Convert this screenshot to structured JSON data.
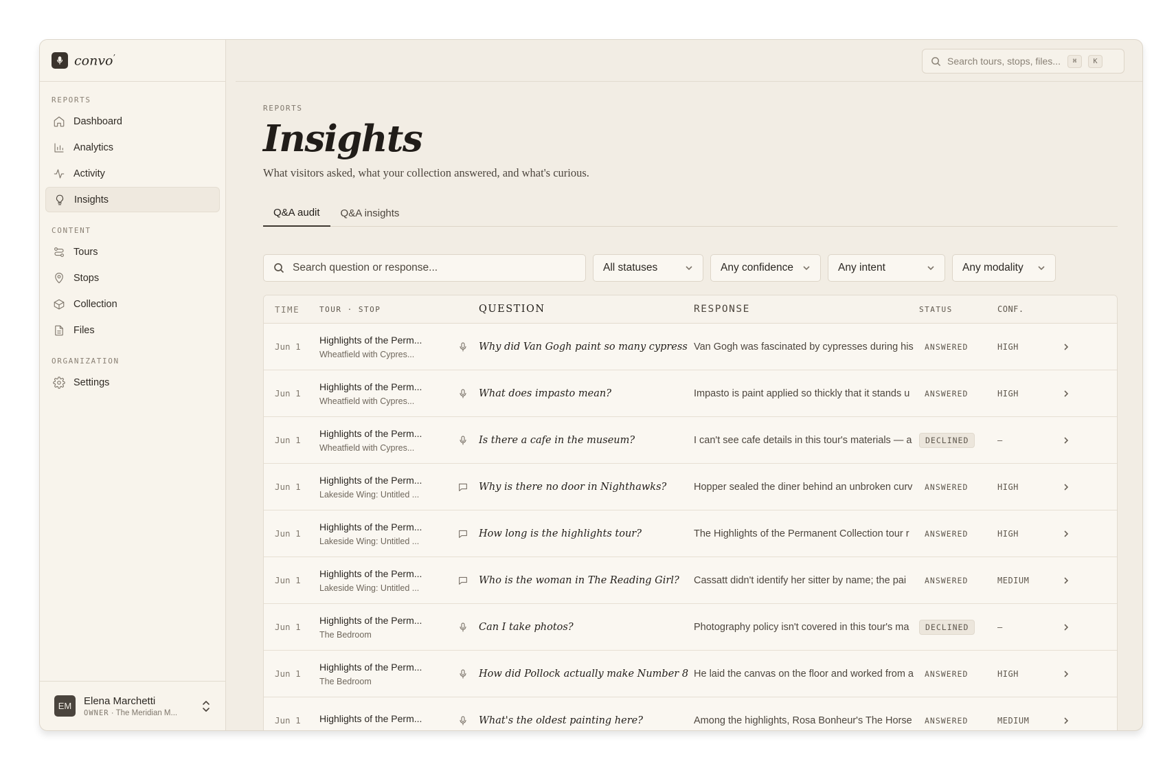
{
  "brand": {
    "name": "convo",
    "mark": "’"
  },
  "sidebar": {
    "sections": [
      {
        "heading": "REPORTS",
        "items": [
          {
            "label": "Dashboard",
            "icon": "home-icon"
          },
          {
            "label": "Analytics",
            "icon": "bar-chart-icon"
          },
          {
            "label": "Activity",
            "icon": "activity-icon"
          },
          {
            "label": "Insights",
            "icon": "lightbulb-icon",
            "active": true
          }
        ]
      },
      {
        "heading": "CONTENT",
        "items": [
          {
            "label": "Tours",
            "icon": "route-icon"
          },
          {
            "label": "Stops",
            "icon": "map-pin-icon"
          },
          {
            "label": "Collection",
            "icon": "box-icon"
          },
          {
            "label": "Files",
            "icon": "file-icon"
          }
        ]
      },
      {
        "heading": "ORGANIZATION",
        "items": [
          {
            "label": "Settings",
            "icon": "gear-icon"
          }
        ]
      }
    ],
    "user": {
      "initials": "EM",
      "name": "Elena Marchetti",
      "role": "OWNER",
      "org": "The Meridian M..."
    }
  },
  "topbar": {
    "search_placeholder": "Search tours, stops, files...",
    "kbd1": "⌘",
    "kbd2": "K"
  },
  "page": {
    "crumb": "REPORTS",
    "title": "Insights",
    "subtitle": "What visitors asked, what your collection answered, and what's curious.",
    "tabs": [
      {
        "label": "Q&A audit",
        "active": true
      },
      {
        "label": "Q&A insights",
        "active": false
      }
    ]
  },
  "filters": {
    "search_placeholder": "Search question or response...",
    "status": "All statuses",
    "confidence": "Any confidence",
    "intent": "Any intent",
    "modality": "Any modality"
  },
  "table": {
    "headers": {
      "time": "TIME",
      "tour": "TOUR · STOP",
      "question": "QUESTION",
      "response": "RESPONSE",
      "status": "STATUS",
      "conf": "CONF."
    },
    "rows": [
      {
        "time": "Jun 1",
        "tour": "Highlights of the Perm...",
        "stop": "Wheatfield with Cypres...",
        "modality": "voice",
        "question": "Why did Van Gogh paint so many cypress",
        "response": "Van Gogh was fascinated by cypresses during his",
        "status": "ANSWERED",
        "conf": "HIGH"
      },
      {
        "time": "Jun 1",
        "tour": "Highlights of the Perm...",
        "stop": "Wheatfield with Cypres...",
        "modality": "voice",
        "question": "What does impasto mean?",
        "response": "Impasto is paint applied so thickly that it stands u",
        "status": "ANSWERED",
        "conf": "HIGH"
      },
      {
        "time": "Jun 1",
        "tour": "Highlights of the Perm...",
        "stop": "Wheatfield with Cypres...",
        "modality": "voice",
        "question": "Is there a cafe in the museum?",
        "response": "I can't see cafe details in this tour's materials — a",
        "status": "DECLINED",
        "conf": "–"
      },
      {
        "time": "Jun 1",
        "tour": "Highlights of the Perm...",
        "stop": "Lakeside Wing: Untitled ...",
        "modality": "chat",
        "question": "Why is there no door in Nighthawks?",
        "response": "Hopper sealed the diner behind an unbroken curv",
        "status": "ANSWERED",
        "conf": "HIGH"
      },
      {
        "time": "Jun 1",
        "tour": "Highlights of the Perm...",
        "stop": "Lakeside Wing: Untitled ...",
        "modality": "chat",
        "question": "How long is the highlights tour?",
        "response": "The Highlights of the Permanent Collection tour r",
        "status": "ANSWERED",
        "conf": "HIGH"
      },
      {
        "time": "Jun 1",
        "tour": "Highlights of the Perm...",
        "stop": "Lakeside Wing: Untitled ...",
        "modality": "chat",
        "question": "Who is the woman in The Reading Girl?",
        "response": "Cassatt didn't identify her sitter by name; the pai",
        "status": "ANSWERED",
        "conf": "MEDIUM"
      },
      {
        "time": "Jun 1",
        "tour": "Highlights of the Perm...",
        "stop": "The Bedroom",
        "modality": "voice",
        "question": "Can I take photos?",
        "response": "Photography policy isn't covered in this tour's ma",
        "status": "DECLINED",
        "conf": "–"
      },
      {
        "time": "Jun 1",
        "tour": "Highlights of the Perm...",
        "stop": "The Bedroom",
        "modality": "voice",
        "question": "How did Pollock actually make Number 8",
        "response": "He laid the canvas on the floor and worked from a",
        "status": "ANSWERED",
        "conf": "HIGH"
      },
      {
        "time": "Jun 1",
        "tour": "Highlights of the Perm...",
        "stop": "",
        "modality": "voice",
        "question": "What's the oldest painting here?",
        "response": "Among the highlights, Rosa Bonheur's The Horse",
        "status": "ANSWERED",
        "conf": "MEDIUM"
      }
    ]
  }
}
